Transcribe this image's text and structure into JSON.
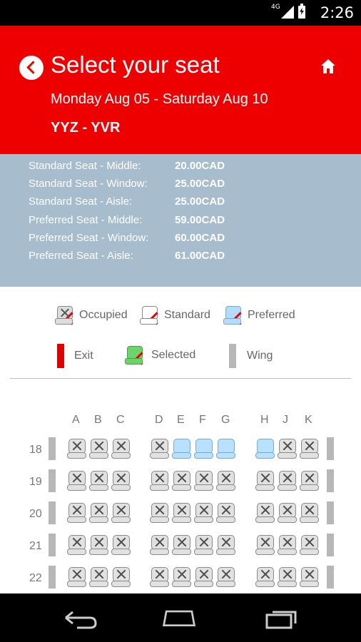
{
  "status": {
    "network": "4G",
    "time": "2:26"
  },
  "header": {
    "title": "Select your seat",
    "dates": "Monday Aug 05 - Saturday Aug 10",
    "route": "YYZ - YVR"
  },
  "prices": [
    {
      "label": "Standard Seat - Middle:",
      "value": "20.00CAD"
    },
    {
      "label": "Standard Seat - Window:",
      "value": "25.00CAD"
    },
    {
      "label": "Standard Seat - Aisle:",
      "value": "25.00CAD"
    },
    {
      "label": "Preferred Seat - Middle:",
      "value": "59.00CAD"
    },
    {
      "label": "Preferred Seat - Window:",
      "value": "60.00CAD"
    },
    {
      "label": "Preferred Seat - Aisle:",
      "value": "61.00CAD"
    }
  ],
  "legend": {
    "occupied": "Occupied",
    "standard": "Standard",
    "preferred": "Preferred",
    "exit": "Exit",
    "selected": "Selected",
    "wing": "Wing"
  },
  "columns": [
    "A",
    "B",
    "C",
    "D",
    "E",
    "F",
    "G",
    "H",
    "J",
    "K"
  ],
  "rows": [
    {
      "number": "18",
      "seats": [
        "occupied",
        "occupied",
        "occupied",
        "occupied",
        "preferred",
        "preferred",
        "preferred",
        "preferred",
        "occupied",
        "occupied"
      ]
    },
    {
      "number": "19",
      "seats": [
        "occupied",
        "occupied",
        "occupied",
        "occupied",
        "occupied",
        "occupied",
        "occupied",
        "occupied",
        "occupied",
        "occupied"
      ]
    },
    {
      "number": "20",
      "seats": [
        "occupied",
        "occupied",
        "occupied",
        "occupied",
        "occupied",
        "occupied",
        "occupied",
        "occupied",
        "occupied",
        "occupied"
      ]
    },
    {
      "number": "21",
      "seats": [
        "occupied",
        "occupied",
        "occupied",
        "occupied",
        "occupied",
        "occupied",
        "occupied",
        "occupied",
        "occupied",
        "occupied"
      ]
    },
    {
      "number": "22",
      "seats": [
        "occupied",
        "occupied",
        "occupied",
        "occupied",
        "occupied",
        "occupied",
        "occupied",
        "occupied",
        "occupied",
        "occupied"
      ]
    }
  ],
  "colors": {
    "header": "#ee0000",
    "price_panel": "#a7bccc",
    "preferred": "#b8e0ff",
    "selected": "#6fd36b",
    "exit": "#e00000",
    "wing": "#b7b7b7"
  }
}
